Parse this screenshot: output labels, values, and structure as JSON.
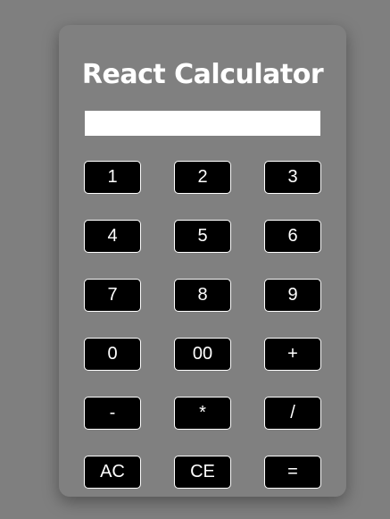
{
  "app": {
    "title": "React Calculator"
  },
  "display": {
    "value": ""
  },
  "keys": [
    {
      "label": "1",
      "name": "key-1-button"
    },
    {
      "label": "2",
      "name": "key-2-button"
    },
    {
      "label": "3",
      "name": "key-3-button"
    },
    {
      "label": "4",
      "name": "key-4-button"
    },
    {
      "label": "5",
      "name": "key-5-button"
    },
    {
      "label": "6",
      "name": "key-6-button"
    },
    {
      "label": "7",
      "name": "key-7-button"
    },
    {
      "label": "8",
      "name": "key-8-button"
    },
    {
      "label": "9",
      "name": "key-9-button"
    },
    {
      "label": "0",
      "name": "key-0-button"
    },
    {
      "label": "00",
      "name": "key-00-button"
    },
    {
      "label": "+",
      "name": "add-button"
    },
    {
      "label": "-",
      "name": "subtract-button"
    },
    {
      "label": "*",
      "name": "multiply-button"
    },
    {
      "label": "/",
      "name": "divide-button"
    },
    {
      "label": "AC",
      "name": "all-clear-button"
    },
    {
      "label": "CE",
      "name": "clear-entry-button"
    },
    {
      "label": "=",
      "name": "equals-button"
    }
  ],
  "colors": {
    "page_background": "#7f7f7f",
    "panel_background": "#808080",
    "key_background": "#000000",
    "key_text": "#ffffff",
    "display_background": "#ffffff"
  }
}
